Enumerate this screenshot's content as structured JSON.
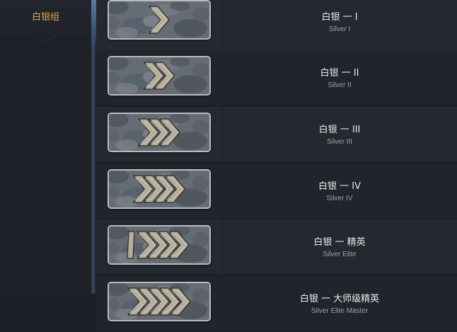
{
  "sidebar": {
    "active_label": "白银组"
  },
  "ranks": [
    {
      "name_cn": "白银 一 I",
      "name_en": "Silver I",
      "chevrons": 1
    },
    {
      "name_cn": "白银 一 II",
      "name_en": "Silver II",
      "chevrons": 2
    },
    {
      "name_cn": "白银 一 III",
      "name_en": "Silver III",
      "chevrons": 3
    },
    {
      "name_cn": "白银 一 IV",
      "name_en": "Silver IV",
      "chevrons": 4
    },
    {
      "name_cn": "白银 一 精英",
      "name_en": "Silver Elite",
      "chevrons": 5
    },
    {
      "name_cn": "白银 一 大师级精英",
      "name_en": "Silver Elite Master",
      "chevrons": 5
    }
  ],
  "colors": {
    "accent": "#e0a53a",
    "background": "#1d2127",
    "chevron": "#b3ad9c"
  }
}
